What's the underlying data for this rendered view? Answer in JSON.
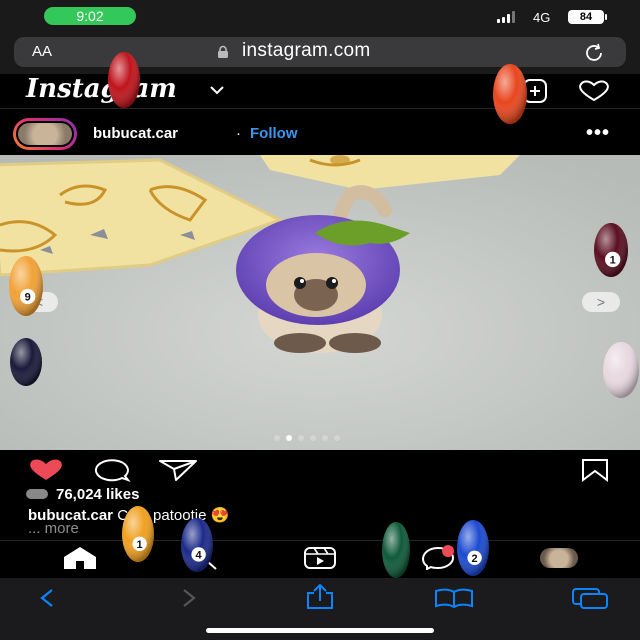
{
  "status": {
    "time": "9:02",
    "network": "4G",
    "battery": "84"
  },
  "browser": {
    "text_size": "AA",
    "url": "instagram.com"
  },
  "instagram": {
    "logo": "Instagram",
    "post": {
      "username": "bubucat.car",
      "separator": "·",
      "follow_label": "Follow",
      "more_label": "•••",
      "carousel": {
        "prev": "<",
        "next": ">",
        "count": 6,
        "active": 1
      },
      "likes": "76,024 likes",
      "caption_user": "bubucat.car",
      "caption_text": "Cute patootie 😍",
      "more_link": "... more"
    }
  },
  "overlay": {
    "balls": [
      {
        "number": "",
        "color": "#c0141c"
      },
      {
        "number": "",
        "color": "#e8461e"
      },
      {
        "number": "9",
        "color": "#f2a236"
      },
      {
        "number": "1",
        "color": "#5a0f20"
      },
      {
        "number": "",
        "color": "#1a1a3a"
      },
      {
        "number": "",
        "color": "#e8d8e0"
      },
      {
        "number": "1",
        "color": "#f0a020"
      },
      {
        "number": "4",
        "color": "#1c2a8a"
      },
      {
        "number": "",
        "color": "#0f5a3a"
      },
      {
        "number": "2",
        "color": "#1c4ad0"
      }
    ]
  },
  "colors": {
    "accent": "#3897f0",
    "like": "#ed4956",
    "background": "#000000",
    "safari_icons": "#0a84ff"
  }
}
